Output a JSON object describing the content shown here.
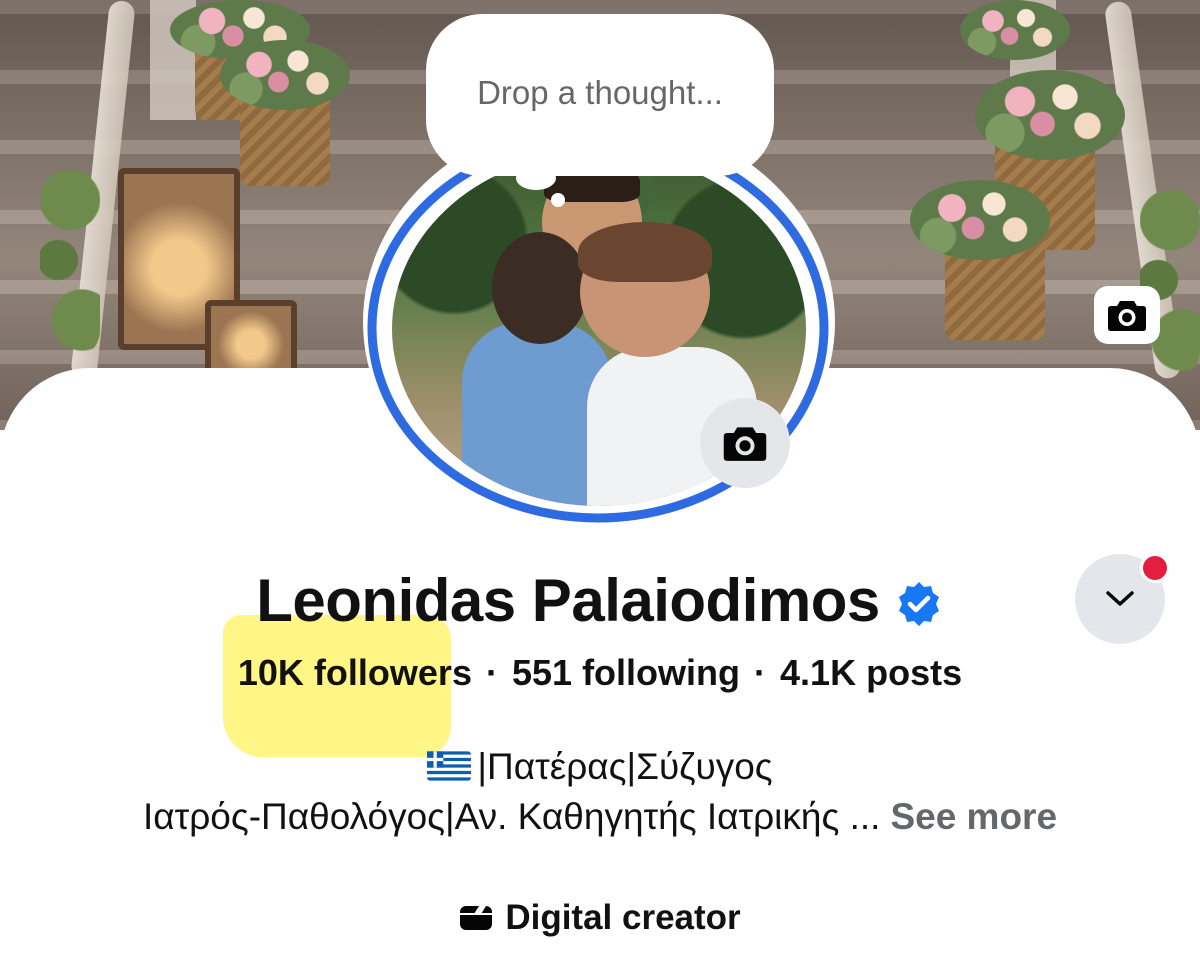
{
  "profile": {
    "name": "Leonidas Palaiodimos",
    "verified": true,
    "thought_placeholder": "Drop a thought...",
    "stats": {
      "followers": "10K followers",
      "following_count": "551",
      "following_label": "following",
      "posts_count": "4.1K",
      "posts_label": "posts",
      "separator": "·"
    },
    "bio": {
      "line1": "|Πατέρας|Σύζυγος",
      "line2": "Ιατρός-Παθολόγος|Αν. Καθηγητής Ιατρικής ...",
      "see_more": "See more"
    },
    "category": "Digital creator"
  },
  "icons": {
    "cover_camera": "camera-icon",
    "avatar_camera": "camera-icon",
    "verified": "verified-badge-icon",
    "dropdown": "chevron-down-icon",
    "category": "category-icon",
    "flag": "greece-flag-icon"
  },
  "colors": {
    "verified_blue": "#1877f2",
    "story_ring": "#2f6be0",
    "notification": "#e41e3f",
    "secondary_text": "#65676b",
    "highlight": "#fff470"
  }
}
